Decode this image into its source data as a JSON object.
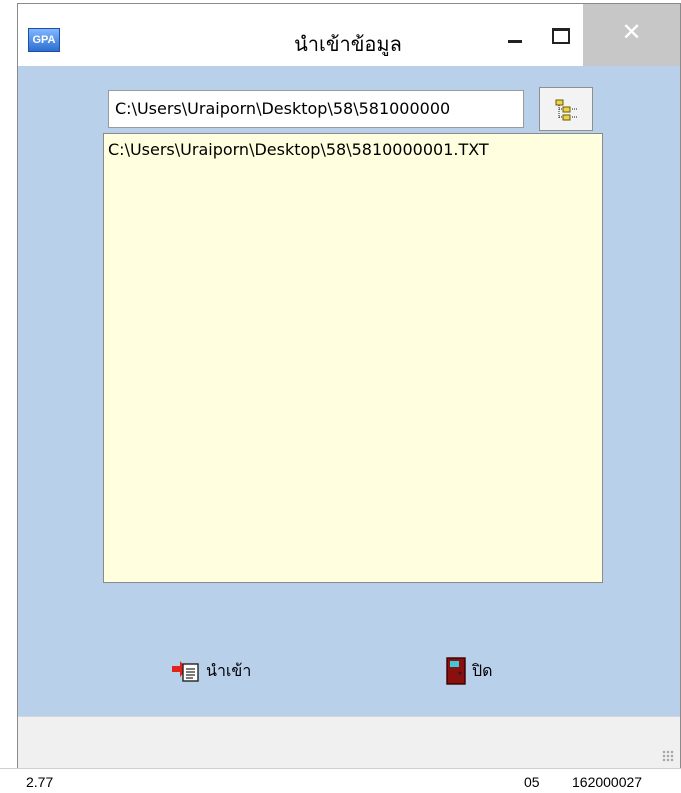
{
  "window": {
    "title": "นำเข้าข้อมูล",
    "app_icon_text": "GPA",
    "close_symbol": "✕"
  },
  "path_field": {
    "value": "C:\\Users\\Uraiporn\\Desktop\\58\\581000000"
  },
  "file_list": {
    "items": [
      "C:\\Users\\Uraiporn\\Desktop\\58\\5810000001.TXT"
    ]
  },
  "buttons": {
    "import_label": "นำเข้า",
    "close_label": "ปิด"
  },
  "background": {
    "cell_left": "2.77",
    "cell_mid": "05",
    "cell_right": "162000027"
  },
  "colors": {
    "client_bg": "#b9d0ea",
    "list_bg": "#ffffdf",
    "close_btn_bg": "#c7c7c7"
  }
}
